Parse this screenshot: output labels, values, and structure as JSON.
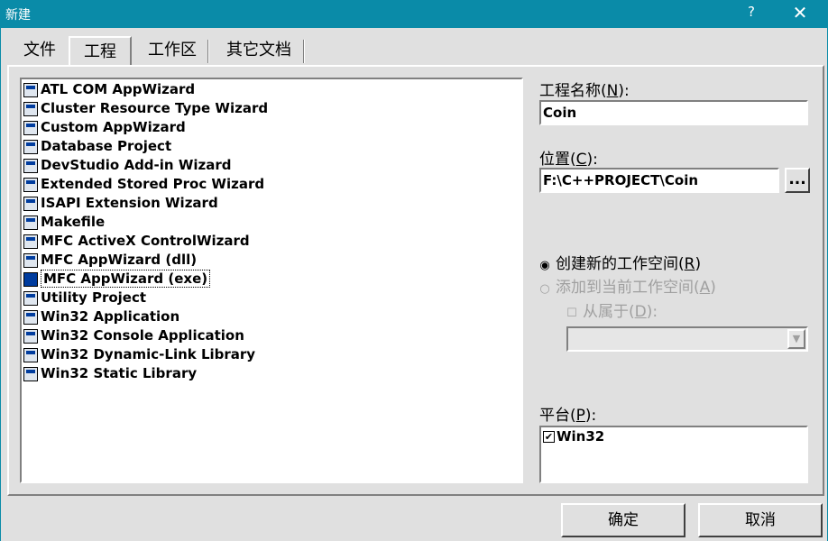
{
  "window": {
    "title": "新建",
    "help_glyph": "?",
    "close_glyph": "✕"
  },
  "tabs": [
    {
      "label": "文件",
      "active": false
    },
    {
      "label": "工程",
      "active": true
    },
    {
      "label": "工作区",
      "active": false
    },
    {
      "label": "其它文档",
      "active": false
    }
  ],
  "project_types": [
    {
      "label": "ATL COM AppWizard"
    },
    {
      "label": "Cluster Resource Type Wizard"
    },
    {
      "label": "Custom AppWizard"
    },
    {
      "label": "Database Project"
    },
    {
      "label": "DevStudio Add-in Wizard"
    },
    {
      "label": "Extended Stored Proc Wizard"
    },
    {
      "label": "ISAPI Extension Wizard"
    },
    {
      "label": "Makefile"
    },
    {
      "label": "MFC ActiveX ControlWizard"
    },
    {
      "label": "MFC AppWizard (dll)"
    },
    {
      "label": "MFC AppWizard (exe)",
      "selected": true
    },
    {
      "label": "Utility Project"
    },
    {
      "label": "Win32 Application"
    },
    {
      "label": "Win32 Console Application"
    },
    {
      "label": "Win32 Dynamic-Link Library"
    },
    {
      "label": "Win32 Static Library"
    }
  ],
  "project_name": {
    "label_text": "工程名称",
    "label_key": "N",
    "value": "Coin"
  },
  "location": {
    "label_text": "位置",
    "label_key": "C",
    "value": "F:\\C++PROJECT\\Coin",
    "browse_label": "..."
  },
  "workspace": {
    "create_new": {
      "label_text": "创建新的工作空间",
      "label_key": "R",
      "checked": true
    },
    "add_to_current": {
      "label_text": "添加到当前工作空间",
      "label_key": "A",
      "checked": false
    },
    "dependency": {
      "label_text": "从属于",
      "label_key": "D",
      "checked": false
    },
    "dependency_combo_value": ""
  },
  "platform": {
    "label_text": "平台",
    "label_key": "P",
    "items": [
      {
        "label": "Win32",
        "checked": true
      }
    ]
  },
  "buttons": {
    "ok": "确定",
    "cancel": "取消"
  }
}
